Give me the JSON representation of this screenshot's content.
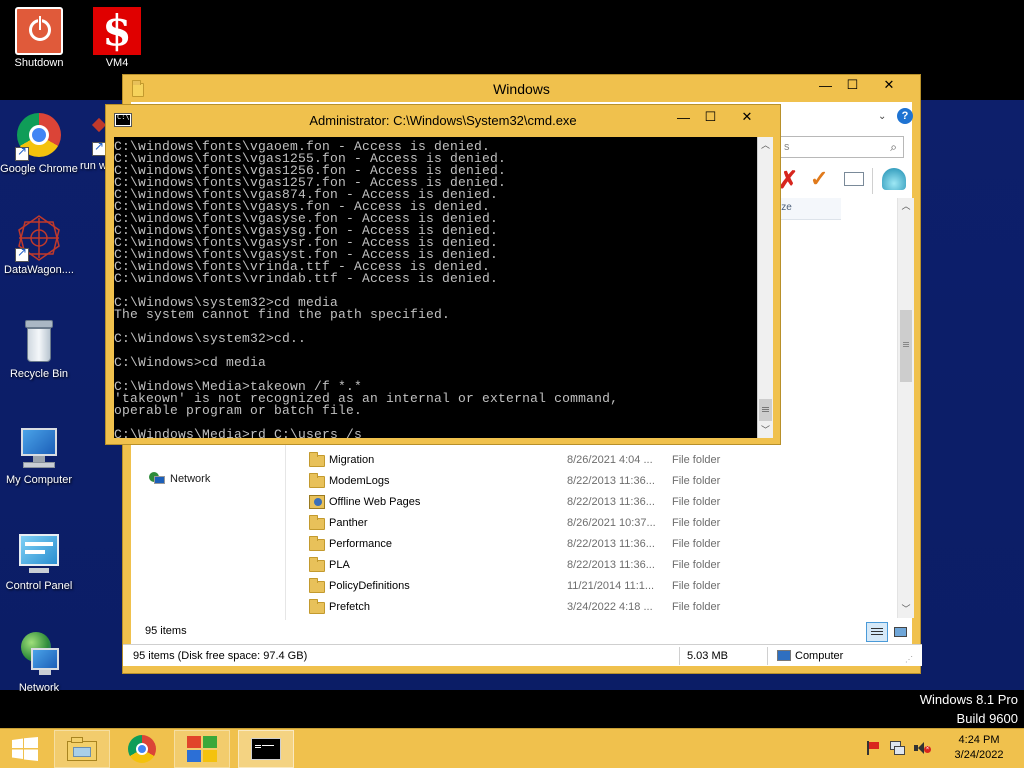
{
  "desktop": {
    "icons": [
      {
        "label": "Shutdown"
      },
      {
        "label": "VM4"
      },
      {
        "label": "Google Chrome"
      },
      {
        "label": "run w"
      },
      {
        "label": "DataWagon...."
      },
      {
        "label": "Recycle Bin"
      },
      {
        "label": "My Computer"
      },
      {
        "label": "Control Panel"
      },
      {
        "label": "Network"
      }
    ],
    "watermark": {
      "line1": "Windows 8.1 Pro",
      "line2": "Build 9600"
    }
  },
  "explorer": {
    "title": "Windows",
    "search_partial": "s",
    "col_partial": "ize",
    "nav": {
      "network": "Network"
    },
    "rows": [
      {
        "name": "Migration",
        "date": "8/26/2021 4:04 ...",
        "type": "File folder"
      },
      {
        "name": "ModemLogs",
        "date": "8/22/2013 11:36...",
        "type": "File folder"
      },
      {
        "name": "Offline Web Pages",
        "date": "8/22/2013 11:36...",
        "type": "File folder"
      },
      {
        "name": "Panther",
        "date": "8/26/2021 10:37...",
        "type": "File folder"
      },
      {
        "name": "Performance",
        "date": "8/22/2013 11:36...",
        "type": "File folder"
      },
      {
        "name": "PLA",
        "date": "8/22/2013 11:36...",
        "type": "File folder"
      },
      {
        "name": "PolicyDefinitions",
        "date": "11/21/2014 11:1...",
        "type": "File folder"
      },
      {
        "name": "Prefetch",
        "date": "3/24/2022 4:18 ...",
        "type": "File folder"
      }
    ],
    "item_count": "95 items",
    "status": {
      "items": "95 items (Disk free space: 97.4 GB)",
      "size": "5.03 MB",
      "location": "Computer"
    }
  },
  "cmd": {
    "title": "Administrator: C:\\Windows\\System32\\cmd.exe",
    "lines": [
      "C:\\windows\\fonts\\vgaoem.fon - Access is denied.",
      "C:\\windows\\fonts\\vgas1255.fon - Access is denied.",
      "C:\\windows\\fonts\\vgas1256.fon - Access is denied.",
      "C:\\windows\\fonts\\vgas1257.fon - Access is denied.",
      "C:\\windows\\fonts\\vgas874.fon - Access is denied.",
      "C:\\windows\\fonts\\vgasys.fon - Access is denied.",
      "C:\\windows\\fonts\\vgasyse.fon - Access is denied.",
      "C:\\windows\\fonts\\vgasysg.fon - Access is denied.",
      "C:\\windows\\fonts\\vgasysr.fon - Access is denied.",
      "C:\\windows\\fonts\\vgasyst.fon - Access is denied.",
      "C:\\windows\\fonts\\vrinda.ttf - Access is denied.",
      "C:\\windows\\fonts\\vrindab.ttf - Access is denied.",
      "",
      "C:\\Windows\\system32>cd media",
      "The system cannot find the path specified.",
      "",
      "C:\\Windows\\system32>cd..",
      "",
      "C:\\Windows>cd media",
      "",
      "C:\\Windows\\Media>takeown /f *.*",
      "'takeown' is not recognized as an internal or external command,",
      "operable program or batch file.",
      "",
      "C:\\Windows\\Media>rd C:\\users /s _"
    ]
  },
  "taskbar": {
    "time": "4:24 PM",
    "date": "3/24/2022"
  }
}
